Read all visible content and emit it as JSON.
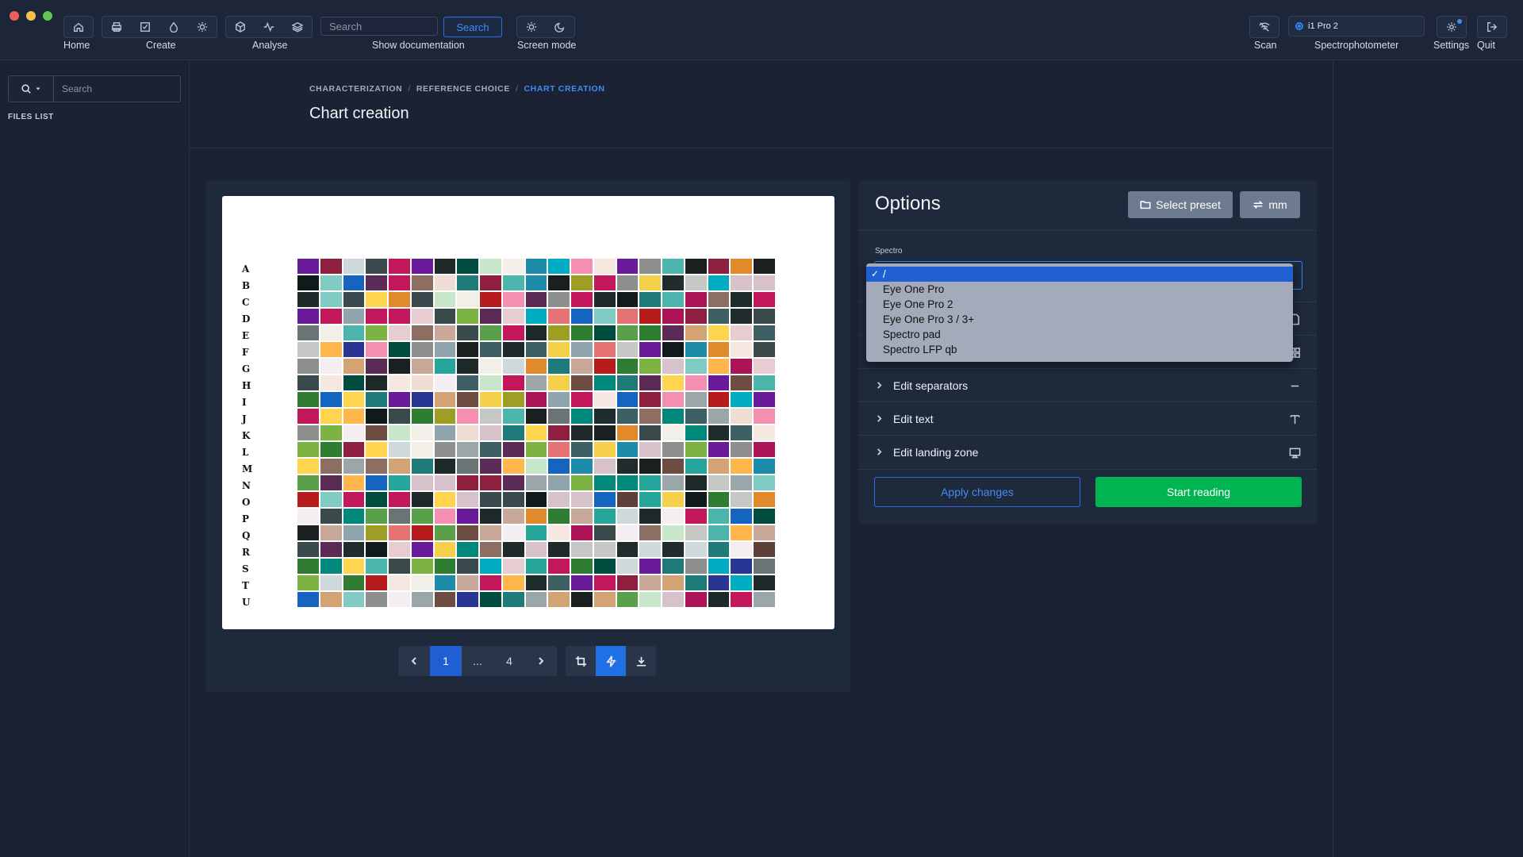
{
  "toolbar": {
    "home_label": "Home",
    "create_label": "Create",
    "analyse_label": "Analyse",
    "search_placeholder": "Search",
    "search_button": "Search",
    "docs_label": "Show documentation",
    "screen_mode_label": "Screen mode",
    "scan_label": "Scan",
    "spectro_value": "i1 Pro 2",
    "spectro_label": "Spectrophotometer",
    "settings_label": "Settings",
    "quit_label": "Quit"
  },
  "sidebar": {
    "search_placeholder": "Search",
    "files_list_label": "FILES LIST"
  },
  "breadcrumb": {
    "items": [
      "CHARACTERIZATION",
      "REFERENCE CHOICE",
      "CHART CREATION"
    ],
    "separator": "/"
  },
  "page_title": "Chart creation",
  "chart": {
    "row_labels": [
      "A",
      "B",
      "C",
      "D",
      "E",
      "F",
      "G",
      "H",
      "I",
      "J",
      "K",
      "L",
      "M",
      "N",
      "O",
      "P",
      "Q",
      "R",
      "S",
      "T",
      "U"
    ],
    "columns": 21,
    "palette": [
      "#c8a898",
      "#3e5f63",
      "#101a1a",
      "#f5e8e0",
      "#1e2a2a",
      "#cfd9dc",
      "#5b2a55",
      "#c4c7c4",
      "#1a1f1f",
      "#efdcd3",
      "#6b7474",
      "#8d8f8f",
      "#3a4a4c",
      "#e7ccd2",
      "#1d8ca8",
      "#f4eef2",
      "#1e2d2b",
      "#d7c2cc",
      "#3a4a4a",
      "#9ba6a8",
      "#f2efe8",
      "#1f7a7a",
      "#c2185b",
      "#2e7d32",
      "#e08a2c",
      "#6a1b9a",
      "#00897b",
      "#f5d04a",
      "#8e1f3e",
      "#5aa04a",
      "#c8e6c9",
      "#26a69a",
      "#ad1457",
      "#f48fb1",
      "#4db6ac",
      "#283593",
      "#ffb74d",
      "#7cb342",
      "#b71c1c",
      "#00acc1",
      "#d4a373",
      "#5d4037",
      "#90a4ae",
      "#e57373",
      "#004d40",
      "#ffd54f",
      "#6d4c41",
      "#80cbc4",
      "#8d6e63",
      "#1565c0",
      "#9e9d24"
    ],
    "pages": {
      "current": "1",
      "ellipsis": "...",
      "last": "4"
    }
  },
  "options": {
    "title": "Options",
    "select_preset_label": "Select preset",
    "unit_label": "mm",
    "spectro_field_label": "Spectro",
    "spectro_options": [
      {
        "label": "/",
        "selected": true
      },
      {
        "label": "Eye One Pro",
        "selected": false
      },
      {
        "label": "Eye One Pro 2",
        "selected": false
      },
      {
        "label": "Eye One Pro 3 / 3+",
        "selected": false
      },
      {
        "label": "Spectro pad",
        "selected": false
      },
      {
        "label": "Spectro LFP qb",
        "selected": false
      }
    ],
    "check_mark": "✓",
    "accordion": [
      {
        "label": "Edit separators",
        "icon": "minus-icon"
      },
      {
        "label": "Edit text",
        "icon": "text-icon"
      },
      {
        "label": "Edit landing zone",
        "icon": "landing-zone-icon"
      }
    ],
    "apply_label": "Apply changes",
    "start_label": "Start reading"
  },
  "colors": {
    "accent": "#2f86f0",
    "success": "#00b452",
    "panel": "#1f293c",
    "background": "#1a2233"
  }
}
